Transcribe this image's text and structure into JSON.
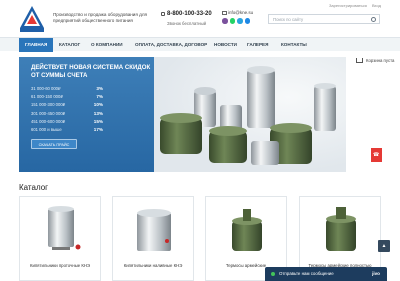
{
  "header": {
    "tagline": "Производство и продажа оборудования для предприятий общественного питания",
    "phone": "8-800-100-33-20",
    "phone_note": "Звонок бесплатный",
    "email": "info@kne.su",
    "top_links": [
      "Зарегистрироваться",
      "Вход"
    ],
    "search_placeholder": "Поиск по сайту",
    "messenger_colors": [
      "#7b519d",
      "#25d366",
      "#2aa3df",
      "#1e88e5"
    ]
  },
  "nav": {
    "items": [
      {
        "label": "Главная",
        "active": true
      },
      {
        "label": "Каталог"
      },
      {
        "label": "О компании"
      },
      {
        "label": "Оплата, доставка, договор"
      },
      {
        "label": "Новости"
      },
      {
        "label": "Галерея"
      },
      {
        "label": "Контакты"
      }
    ]
  },
  "hero": {
    "title": "Действует новая система скидок от суммы счета",
    "discounts": [
      {
        "range": "31 000-60 000₽",
        "percent": "3%"
      },
      {
        "range": "61 000-150 000₽",
        "percent": "7%"
      },
      {
        "range": "151 000-300 000₽",
        "percent": "10%"
      },
      {
        "range": "301 000-450 000₽",
        "percent": "13%"
      },
      {
        "range": "451 000-600 000₽",
        "percent": "15%"
      },
      {
        "range": "601 000 и выше",
        "percent": "17%"
      }
    ],
    "button_label": "Скачать прайс"
  },
  "cart": {
    "label": "Корзина пуста"
  },
  "catalog": {
    "heading": "Каталог",
    "items": [
      {
        "label": "Кипятильники проточные КНЭ"
      },
      {
        "label": "Кипятильники наливные КНЭ"
      },
      {
        "label": "Термосы армейские"
      },
      {
        "label": "Термосы армейские полностью"
      }
    ]
  },
  "chat": {
    "label": "Отправьте нам сообщение",
    "icon_text": "jivo"
  },
  "colors": {
    "accent": "#2a75ba",
    "chat": "#1d3c5e",
    "red": "#e53935"
  }
}
